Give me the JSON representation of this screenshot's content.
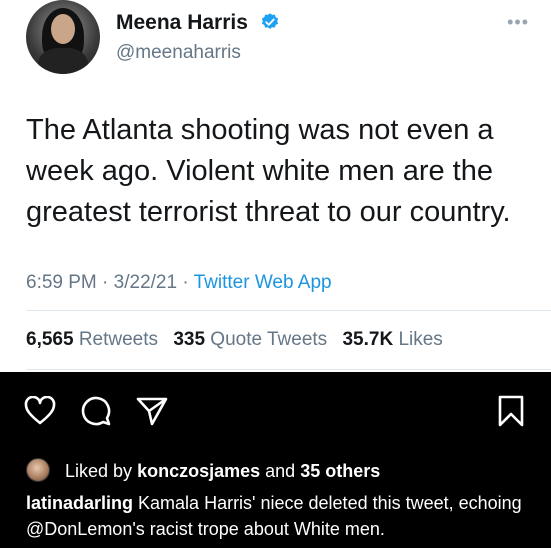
{
  "tweet": {
    "author_name": "Meena Harris",
    "handle": "@meenaharris",
    "more_icon": "more-icon",
    "text": "The Atlanta shooting was not even a week ago. Violent white men are the greatest terrorist threat to our country.",
    "time": "6:59 PM",
    "date": "3/22/21",
    "source": "Twitter Web App",
    "separator": "·",
    "stats": {
      "retweets_count": "6,565",
      "retweets_label": "Retweets",
      "quotes_count": "335",
      "quotes_label": "Quote Tweets",
      "likes_count": "35.7K",
      "likes_label": "Likes"
    }
  },
  "instagram": {
    "actions": [
      "heart-icon",
      "comment-icon",
      "share-icon",
      "bookmark-icon"
    ],
    "liked_prefix": "Liked by",
    "liked_user": "konczosjames",
    "liked_mid": "and",
    "liked_others": "35 others",
    "caption_user": "latinadarling",
    "caption_text": "Kamala Harris' niece deleted this tweet, echoing @DonLemon's racist trope about White men."
  },
  "colors": {
    "verified": "#1da1f2",
    "link": "#1b95e0",
    "muted": "#657786"
  }
}
